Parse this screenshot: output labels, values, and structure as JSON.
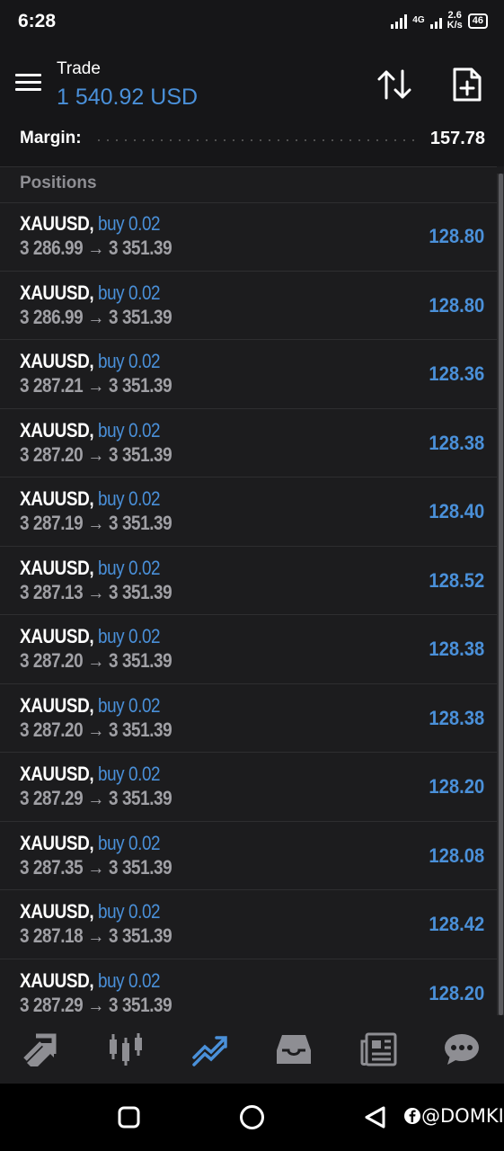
{
  "status": {
    "time": "6:28",
    "network": "4G",
    "speed_value": "2.6",
    "speed_unit": "K/s",
    "battery": "46"
  },
  "header": {
    "title": "Trade",
    "balance": "1 540.92 USD",
    "margin_label": "Margin:",
    "margin_value": "157.78"
  },
  "positions": {
    "label": "Positions",
    "items": [
      {
        "symbol": "XAUUSD,",
        "side": "buy 0.02",
        "open": "3 286.99",
        "arrow": "→",
        "current": "3 351.39",
        "profit": "128.80"
      },
      {
        "symbol": "XAUUSD,",
        "side": "buy 0.02",
        "open": "3 286.99",
        "arrow": "→",
        "current": "3 351.39",
        "profit": "128.80"
      },
      {
        "symbol": "XAUUSD,",
        "side": "buy 0.02",
        "open": "3 287.21",
        "arrow": "→",
        "current": "3 351.39",
        "profit": "128.36"
      },
      {
        "symbol": "XAUUSD,",
        "side": "buy 0.02",
        "open": "3 287.20",
        "arrow": "→",
        "current": "3 351.39",
        "profit": "128.38"
      },
      {
        "symbol": "XAUUSD,",
        "side": "buy 0.02",
        "open": "3 287.19",
        "arrow": "→",
        "current": "3 351.39",
        "profit": "128.40"
      },
      {
        "symbol": "XAUUSD,",
        "side": "buy 0.02",
        "open": "3 287.13",
        "arrow": "→",
        "current": "3 351.39",
        "profit": "128.52"
      },
      {
        "symbol": "XAUUSD,",
        "side": "buy 0.02",
        "open": "3 287.20",
        "arrow": "→",
        "current": "3 351.39",
        "profit": "128.38"
      },
      {
        "symbol": "XAUUSD,",
        "side": "buy 0.02",
        "open": "3 287.20",
        "arrow": "→",
        "current": "3 351.39",
        "profit": "128.38"
      },
      {
        "symbol": "XAUUSD,",
        "side": "buy 0.02",
        "open": "3 287.29",
        "arrow": "→",
        "current": "3 351.39",
        "profit": "128.20"
      },
      {
        "symbol": "XAUUSD,",
        "side": "buy 0.02",
        "open": "3 287.35",
        "arrow": "→",
        "current": "3 351.39",
        "profit": "128.08"
      },
      {
        "symbol": "XAUUSD,",
        "side": "buy 0.02",
        "open": "3 287.18",
        "arrow": "→",
        "current": "3 351.39",
        "profit": "128.42"
      },
      {
        "symbol": "XAUUSD,",
        "side": "buy 0.02",
        "open": "3 287.29",
        "arrow": "→",
        "current": "3 351.39",
        "profit": "128.20"
      }
    ]
  },
  "bottom_nav": [
    {
      "icon": "quotes-icon"
    },
    {
      "icon": "chart-icon"
    },
    {
      "icon": "trade-icon",
      "active": true
    },
    {
      "icon": "history-icon"
    },
    {
      "icon": "news-icon"
    },
    {
      "icon": "chat-icon"
    }
  ],
  "watermark": "@DOMKI",
  "colors": {
    "accent": "#4a90d9",
    "background": "#1c1c1e",
    "header_bg": "#161618",
    "muted": "#a0a0a5"
  }
}
